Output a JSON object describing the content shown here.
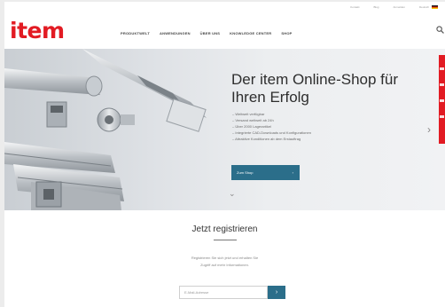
{
  "topbar": {
    "links": [
      "Kontakt",
      "Blog",
      "Anmelden",
      "Deutsch"
    ]
  },
  "header": {
    "logo": "item",
    "nav": [
      "PRODUKTWELT",
      "ANWENDUNGEN",
      "ÜBER UNS",
      "KNOWLEDGE CENTER",
      "SHOP"
    ]
  },
  "hero": {
    "headline": "Der item Online-Shop für Ihren Erfolg",
    "bullets": [
      "Weltweit verfügbar",
      "Versand weltweit ab 24h",
      "Über 2000 Lagerartikel",
      "Integrierte CAD-Downloads und Konfigurationen",
      "Attraktive Konditionen ab dem Erstauftrag"
    ],
    "button": "Zum Shop",
    "button_arrow": "›",
    "next_arrow": "›",
    "scroll_hint": "⌄"
  },
  "register": {
    "title": "Jetzt registrieren",
    "text_line1": "Registrieren Sie sich jetzt und erhalten Sie",
    "text_line2": "Zugriff auf mehr Informationen.",
    "input_placeholder": "E-Mail-Adresse",
    "submit": "›"
  },
  "colors": {
    "brand_red": "#e21b23",
    "accent_blue": "#2b6e8a"
  }
}
